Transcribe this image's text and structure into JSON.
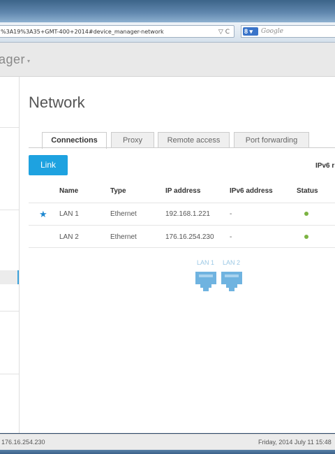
{
  "browser": {
    "url": "%3A19%3A35+GMT-400+2014#device_manager-network",
    "url_icons": "▽ C",
    "search_engine_badge": "8 ▾",
    "search_placeholder": "Google"
  },
  "app": {
    "title": "ager",
    "title_caret": "▾"
  },
  "page": {
    "title": "Network"
  },
  "tabs": [
    {
      "label": "Connections",
      "active": true
    },
    {
      "label": "Proxy",
      "active": false
    },
    {
      "label": "Remote access",
      "active": false
    },
    {
      "label": "Port forwarding",
      "active": false
    }
  ],
  "actions": {
    "link_label": "Link",
    "ipv6_label": "IPv6 r"
  },
  "table": {
    "headers": [
      "Name",
      "Type",
      "IP address",
      "IPv6 address",
      "Status"
    ],
    "rows": [
      {
        "name": "LAN 1",
        "type": "Ethernet",
        "ip": "192.168.1.221",
        "ipv6": "-",
        "status": "connected",
        "starred": true
      },
      {
        "name": "LAN 2",
        "type": "Ethernet",
        "ip": "176.16.254.230",
        "ipv6": "-",
        "status": "connected",
        "starred": false
      }
    ]
  },
  "ports": [
    {
      "label": "LAN 1"
    },
    {
      "label": "LAN 2"
    }
  ],
  "footer": {
    "ip": "176.16.254.230",
    "datetime": "Friday, 2014 July 11  15:48"
  },
  "colors": {
    "accent": "#1ea2e0",
    "status_ok": "#7cb342",
    "star": "#1e88d0",
    "port": "#6fb3e0"
  },
  "icons": {
    "star": "star-icon",
    "status": "status-dot-icon",
    "port": "ethernet-port-icon"
  }
}
